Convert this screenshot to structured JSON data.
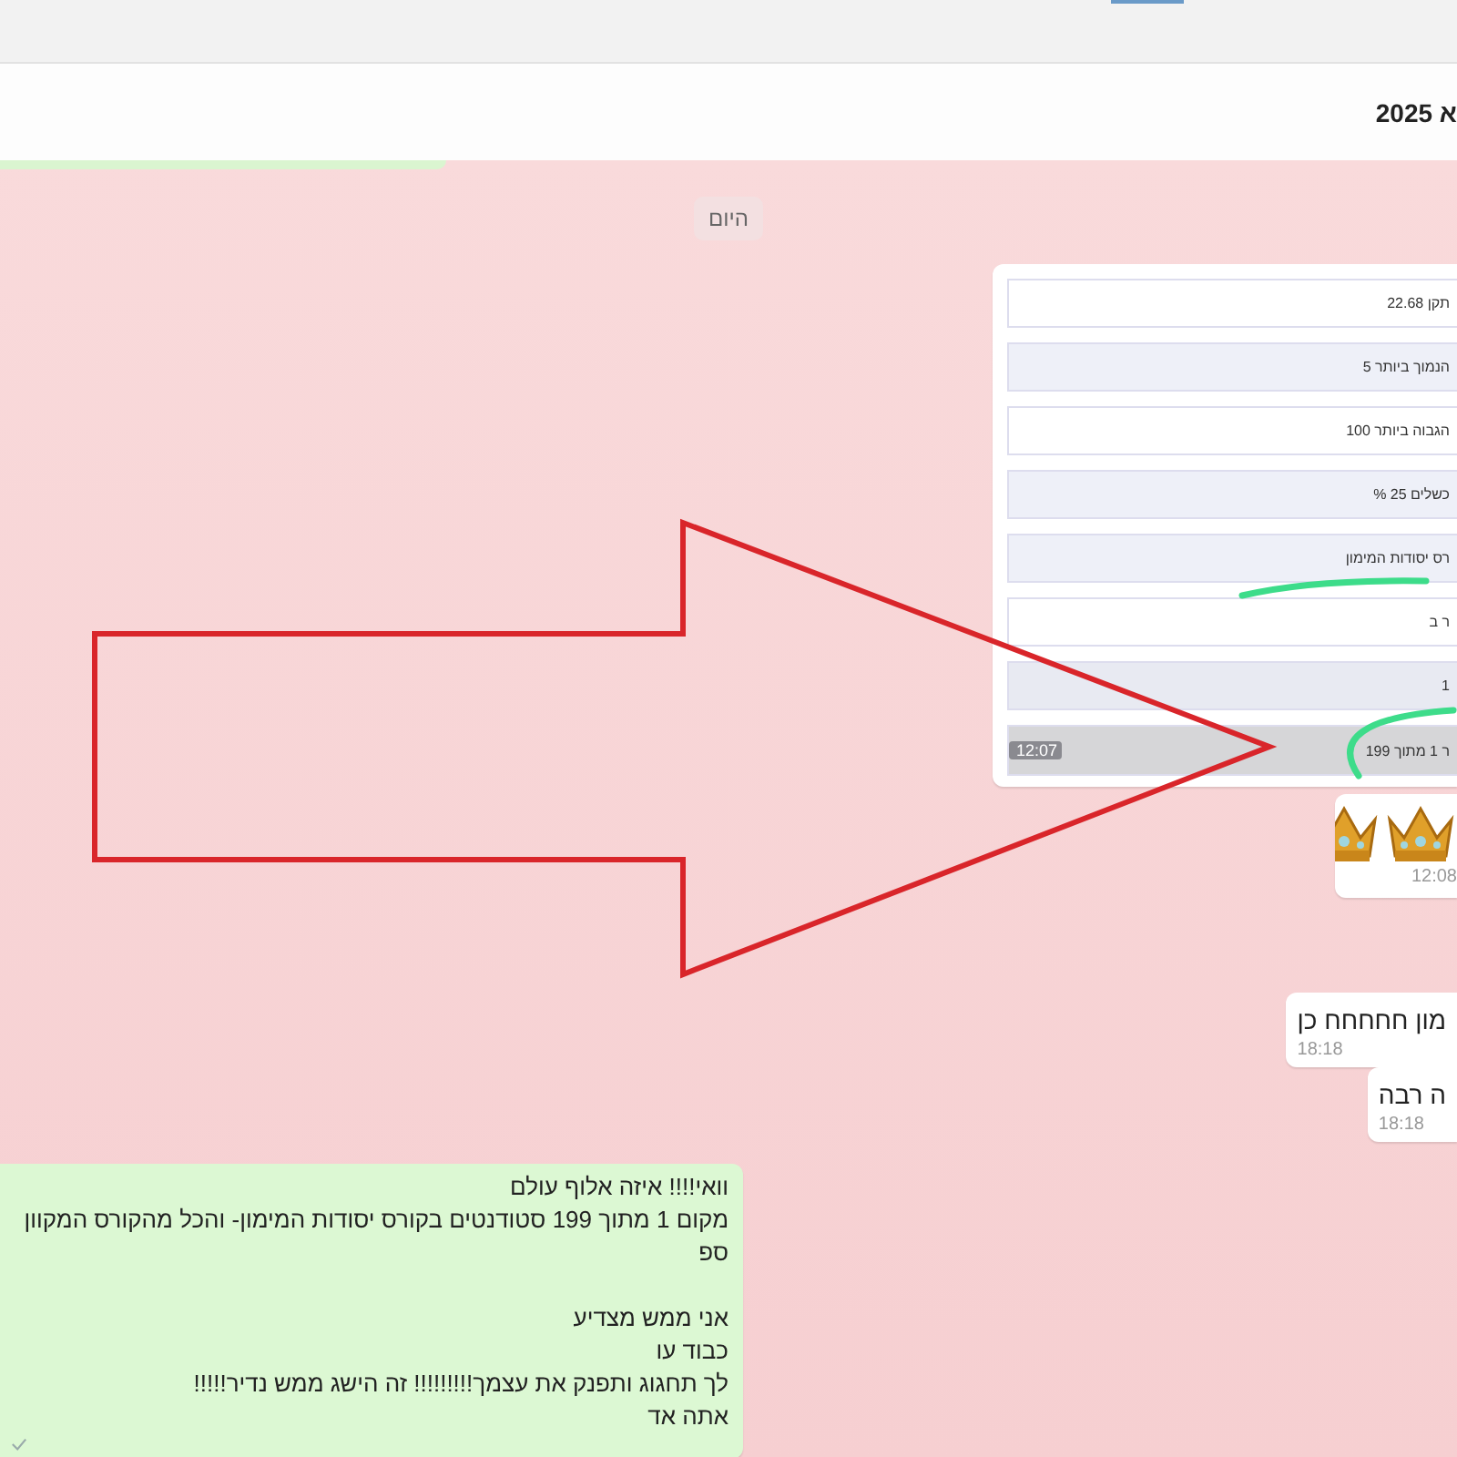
{
  "header": {
    "title": "א 2025"
  },
  "day_chip": "היום",
  "messages": [
    {
      "kind": "table_image",
      "sent": false,
      "time": "12:07",
      "rows": [
        {
          "text": "תקן 22.68",
          "color": "#ffffff"
        },
        {
          "text": "הנמוך ביותר 5",
          "color": "#eef0f8"
        },
        {
          "text": "הגבוה ביותר 100",
          "color": "#ffffff"
        },
        {
          "text": "כשלים 25 %",
          "color": "#eef0f8"
        },
        {
          "text": "רס יסודות המימון",
          "color": "#eef0f8"
        },
        {
          "text": "ר ב",
          "color": "#ffffff"
        },
        {
          "text": "1",
          "color": "#e8eaf2"
        },
        {
          "text": "ר 1 מתוך 199",
          "color": "#d6d6d8"
        }
      ]
    },
    {
      "kind": "crowns",
      "sent": false,
      "time": "12:08"
    },
    {
      "kind": "text",
      "sent": false,
      "time": "18:18",
      "paragraphs": [
        [
          "מון חחחחח כן"
        ]
      ]
    },
    {
      "kind": "text",
      "sent": false,
      "time": "18:18",
      "paragraphs": [
        [
          "ה רבה"
        ]
      ]
    },
    {
      "kind": "text",
      "sent": true,
      "read": true,
      "paragraphs": [
        [
          "וואי!!!! איזה אלוף עולם",
          "מקום 1 מתוך 199 סטודנטים בקורס יסודות המימון- והכל מהקורס המקוון",
          "ספ"
        ],
        [
          "אני ממש מצדיע",
          "כבוד עו",
          "לך תחגוג ותפנק את עצמך!!!!!!!!! זה הישג ממש נדיר!!!!!",
          "אתה אד"
        ]
      ]
    }
  ]
}
